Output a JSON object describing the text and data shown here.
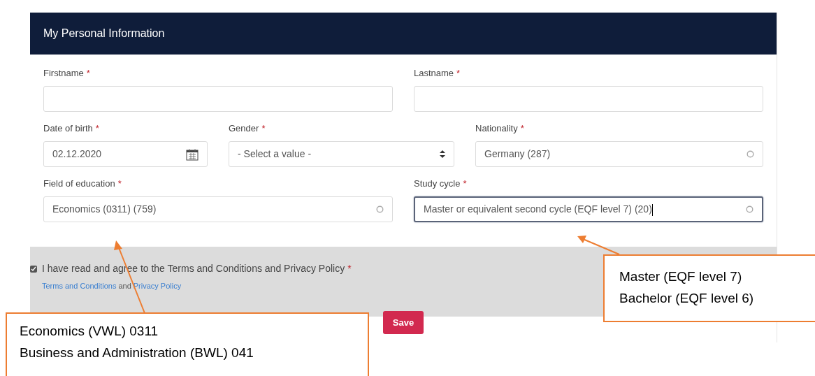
{
  "card": {
    "title": "My Personal Information"
  },
  "rows": [
    {
      "fields": [
        {
          "label": "Firstname",
          "required_mark": "*",
          "kind": "text",
          "focused": false
        },
        {
          "label": "Lastname",
          "required_mark": "*",
          "kind": "text",
          "focused": false
        }
      ]
    },
    {
      "fields": [
        {
          "label": "Date of birth",
          "required_mark": "*",
          "kind": "date",
          "value": "02.12.2020",
          "focused": false
        },
        {
          "label": "Gender",
          "required_mark": "*",
          "kind": "select",
          "placeholder": "- Select a value -",
          "focused": false
        },
        {
          "label": "Nationality",
          "required_mark": "*",
          "kind": "autocomplete",
          "value": "Germany (287)",
          "focused": false
        }
      ]
    },
    {
      "fields": [
        {
          "label": "Field of education",
          "required_mark": "*",
          "kind": "autocomplete",
          "value": "Economics (0311) (759)",
          "focused": false
        },
        {
          "label": "Study cycle",
          "required_mark": "*",
          "kind": "autocomplete",
          "value": "Master or equivalent second cycle (EQF level 7) (20)",
          "focused": true
        }
      ]
    }
  ],
  "consent": {
    "label": "I have read and agree to the Terms and Conditions and Privacy Policy",
    "required_mark": "*",
    "checked": true,
    "links": [
      {
        "text": "Terms and Conditions"
      },
      {
        "text": "and",
        "kind": "plain"
      },
      {
        "text": "Privacy Policy"
      }
    ]
  },
  "save_button": "Save",
  "callouts": [
    {
      "lines": [
        "Economics (VWL) 0311",
        "Business and Administration (BWL) 041"
      ]
    },
    {
      "lines": [
        "Master (EQF level 7)",
        "Bachelor (EQF level 6)"
      ]
    }
  ]
}
